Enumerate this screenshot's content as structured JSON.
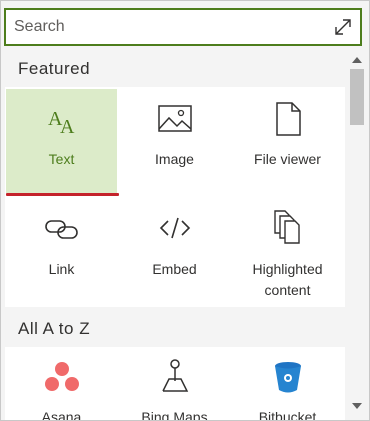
{
  "search": {
    "placeholder": "Search"
  },
  "icons": {
    "expand": "expand-icon",
    "text": "text-size-icon",
    "image": "image-icon",
    "file_viewer": "document-icon",
    "link": "link-icon",
    "embed": "code-icon",
    "highlighted": "copy-documents-icon",
    "asana": "asana-logo",
    "bing_maps": "map-pin-icon",
    "bitbucket": "bitbucket-logo"
  },
  "colors": {
    "accent": "#4d7d1c",
    "selected_background": "#dcebc9",
    "selection_bar": "#c4232b"
  },
  "featured": {
    "header": "Featured",
    "items": [
      {
        "label": "Text",
        "selected": true
      },
      {
        "label": "Image",
        "selected": false
      },
      {
        "label": "File viewer",
        "selected": false
      },
      {
        "label": "Link",
        "selected": false
      },
      {
        "label": "Embed",
        "selected": false
      },
      {
        "label": "Highlighted",
        "label2": "content",
        "selected": false
      }
    ]
  },
  "all": {
    "header": "All A to Z",
    "items": [
      {
        "label": "Asana"
      },
      {
        "label": "Bing Maps"
      },
      {
        "label": "Bitbucket"
      }
    ]
  }
}
